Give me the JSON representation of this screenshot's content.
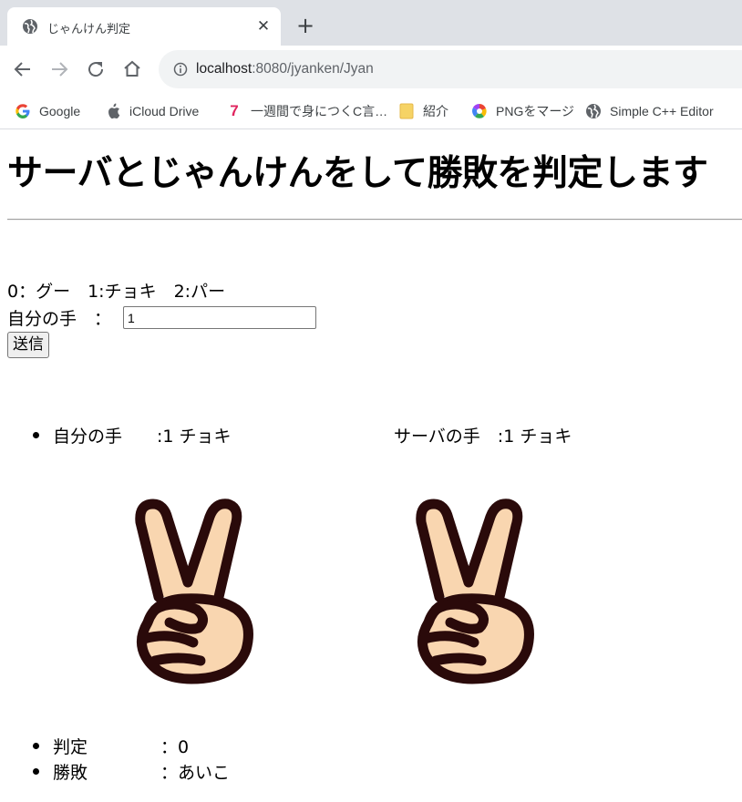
{
  "browser": {
    "tab_title": "じゃんけん判定",
    "tab_close": "✕",
    "new_tab": "+",
    "url_host": "localhost",
    "url_rest": ":8080/jyanken/Jyan",
    "bookmarks": [
      {
        "label": "Google",
        "icon": "google-icon"
      },
      {
        "label": "iCloud Drive",
        "icon": "apple-icon"
      },
      {
        "label": "一週間で身につくC言…",
        "icon": "seven-icon"
      },
      {
        "label": "紹介",
        "icon": "folder-icon"
      },
      {
        "label": "PNGをマージ",
        "icon": "pinwheel-icon"
      },
      {
        "label": "Simple C++ Editor",
        "icon": "globe-icon"
      }
    ],
    "colors": {
      "tabstrip": "#dee1e6",
      "omnibox": "#f1f3f4",
      "icon": "#5f6368",
      "seven": "#e0245e",
      "folder": "#f6d365"
    }
  },
  "page": {
    "heading": "サーバとじゃんけんをして勝敗を判定します",
    "legend": "0：グー　1:チョキ　2:パー",
    "my_hand_label": "自分の手　：",
    "my_hand_value": "1",
    "submit_label": "送信",
    "result": {
      "my_hand": "自分の手　　:1 チョキ",
      "server_hand": "サーバの手　:1 チョキ",
      "my_hand_icon": "peace-sign-hand-icon",
      "server_hand_icon": "peace-sign-hand-icon",
      "judge_label": "判定",
      "judge_value": "：0",
      "outcome_label": "勝敗",
      "outcome_value": "：あいこ"
    }
  }
}
